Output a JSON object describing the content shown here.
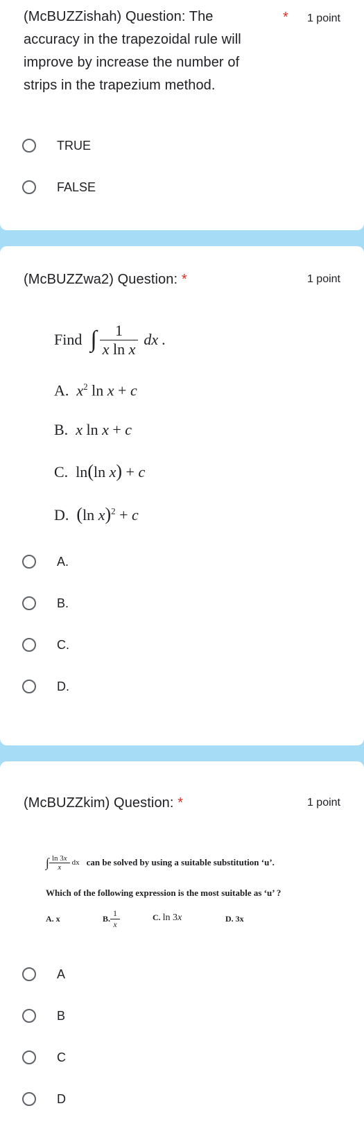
{
  "q1": {
    "title": "(McBUZZishah) Question: The accuracy in the trapezoidal rule will improve by increase the number of strips in the trapezium method.",
    "line1": "(McBUZZishah) Question: The",
    "line2": "accuracy in the trapezoidal rule will",
    "line3": "improve by increase the number of",
    "line4": "strips in the trapezium method.",
    "required": "*",
    "points": "1 point",
    "options": [
      "TRUE",
      "FALSE"
    ]
  },
  "q2": {
    "title": "(McBUZZwa2) Question:",
    "required": "*",
    "points": "1 point",
    "prompt_find": "Find",
    "prompt_dx": "dx .",
    "choices": {
      "a_label": "A.",
      "b_label": "B.",
      "c_label": "C.",
      "d_label": "D."
    },
    "options": [
      "A.",
      "B.",
      "C.",
      "D."
    ]
  },
  "q3": {
    "title": "(McBUZZkim) Question:",
    "required": "*",
    "points": "1 point",
    "line1_text": "can be solved by using a suitable substitution ‘u’.",
    "line2_text": "Which of the following expression is the most suitable as ‘u’ ?",
    "choice_a": "A. x",
    "choice_b": "B.",
    "choice_c": "C.",
    "choice_d": "D. 3x",
    "options": [
      "A",
      "B",
      "C",
      "D"
    ]
  },
  "colors": {
    "background": "#a6dcf6",
    "card": "#ffffff",
    "required": "#d93025",
    "radio_border": "#5f6368"
  }
}
